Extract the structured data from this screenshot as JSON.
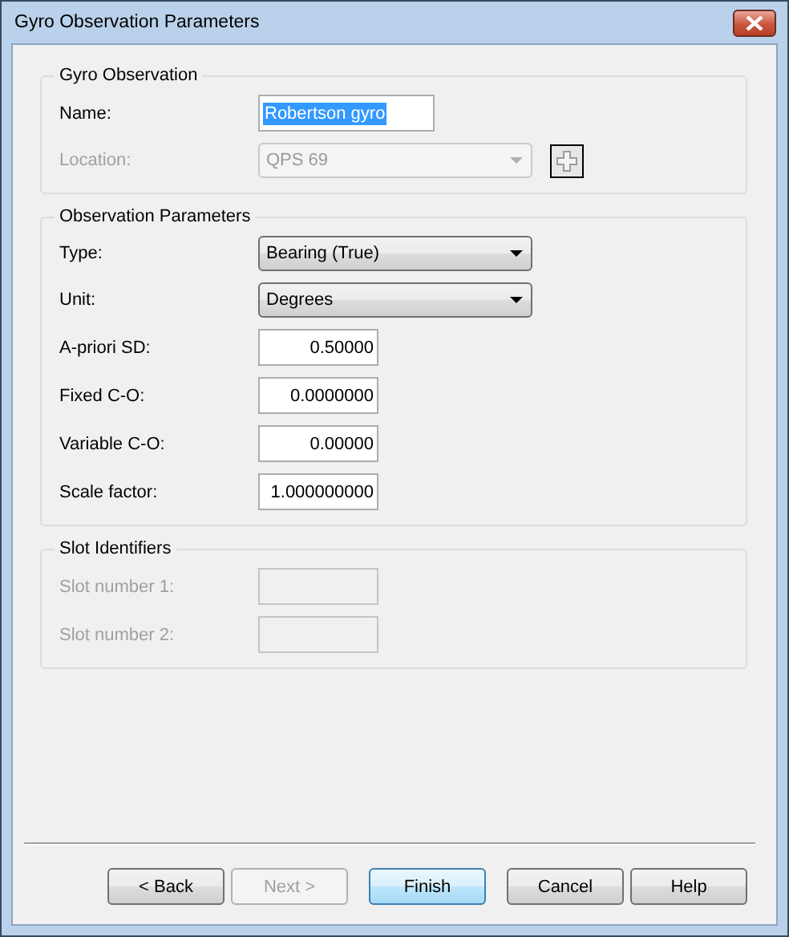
{
  "window": {
    "title": "Gyro Observation Parameters"
  },
  "groups": [
    {
      "title": "Gyro Observation",
      "fields": [
        {
          "label": "Name:",
          "kind": "text",
          "value": "Robertson gyro",
          "highlighted": true,
          "disabled": false
        },
        {
          "label": "Location:",
          "kind": "picker",
          "value": "QPS 69",
          "disabled": true
        }
      ]
    },
    {
      "title": "Observation Parameters",
      "fields": [
        {
          "label": "Type:",
          "kind": "combo",
          "value": "Bearing (True)",
          "disabled": false
        },
        {
          "label": "Unit:",
          "kind": "combo",
          "value": "Degrees",
          "disabled": false
        },
        {
          "label": "A-priori SD:",
          "kind": "number",
          "value": "0.50000",
          "disabled": false
        },
        {
          "label": "Fixed C-O:",
          "kind": "number",
          "value": "0.0000000",
          "disabled": false
        },
        {
          "label": "Variable C-O:",
          "kind": "number",
          "value": "0.00000",
          "disabled": false
        },
        {
          "label": "Scale factor:",
          "kind": "number",
          "value": "1.000000000",
          "disabled": false
        }
      ]
    },
    {
      "title": "Slot Identifiers",
      "fields": [
        {
          "label": "Slot number 1:",
          "kind": "number",
          "disabled": true
        },
        {
          "label": "Slot number 2:",
          "kind": "number",
          "disabled": true
        }
      ]
    }
  ],
  "buttons": [
    {
      "label": "< Back",
      "disabled": false,
      "default": false
    },
    {
      "label": "Next >",
      "disabled": true,
      "default": false
    },
    {
      "label": "Finish",
      "disabled": false,
      "default": true
    },
    {
      "label": "Cancel",
      "disabled": false,
      "default": false
    },
    {
      "label": "Help",
      "disabled": false,
      "default": false
    }
  ]
}
